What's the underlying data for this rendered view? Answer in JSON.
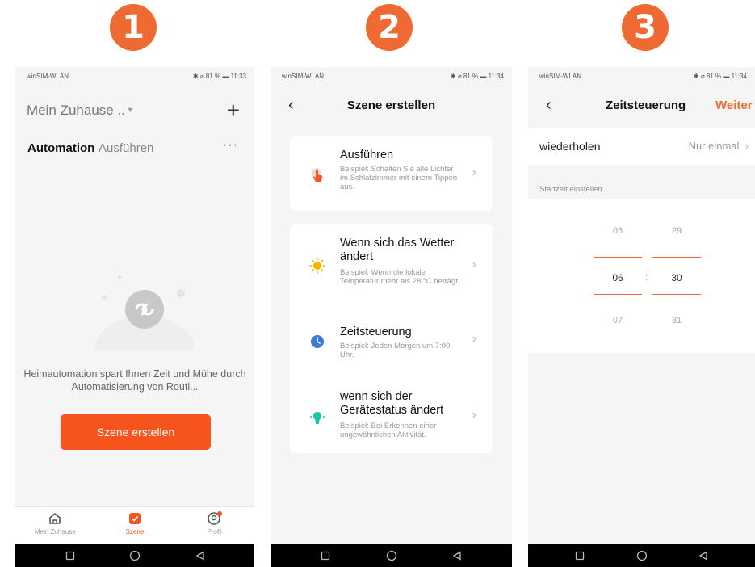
{
  "steps": [
    "1",
    "2",
    "3"
  ],
  "colors": {
    "accent": "#f6541c",
    "badge": "#ee6a32"
  },
  "phone1": {
    "status": {
      "carrier": "winSIM-WLAN",
      "right": "81 %",
      "time": "11:33"
    },
    "home_title": "Mein Zuhause ..",
    "tabs": {
      "automation": "Automation",
      "run": "Ausführen"
    },
    "more_icon": "more-horizontal-icon",
    "empty_text": "Heimautomation spart Ihnen Zeit und Mühe durch Automatisierung von Routi...",
    "create_button": "Szene erstellen",
    "bottom_tabs": [
      {
        "label": "Mein Zuhause",
        "icon": "home-icon"
      },
      {
        "label": "Szene",
        "icon": "scene-check-icon"
      },
      {
        "label": "Profil",
        "icon": "profile-icon"
      }
    ]
  },
  "phone2": {
    "status": {
      "carrier": "winSIM-WLAN",
      "right": "81 %",
      "time": "11:34"
    },
    "title": "Szene erstellen",
    "items": [
      {
        "title": "Ausführen",
        "desc": "Beispiel: Schalten Sie alle Lichter im Schlafzimmer mit einem Tippen aus.",
        "icon": "tap-hand-icon"
      },
      {
        "title": "Wenn sich das Wetter ändert",
        "desc": "Beispiel: Wenn die lokale Temperatur mehr als 28 °C beträgt.",
        "icon": "sun-icon"
      },
      {
        "title": "Zeitsteuerung",
        "desc": "Beispiel: Jeden Morgen um 7:00 Uhr.",
        "icon": "clock-icon"
      },
      {
        "title": "wenn sich der Gerätestatus ändert",
        "desc": "Beispiel: Bei Erkennen einer ungewöhnlichen Aktivität.",
        "icon": "device-bulb-icon"
      }
    ]
  },
  "phone3": {
    "status": {
      "carrier": "winSIM-WLAN",
      "right": "81 %",
      "time": "11:34"
    },
    "title": "Zeitsteuerung",
    "next": "Weiter",
    "repeat_label": "wiederholen",
    "repeat_value": "Nur einmal",
    "start_label": "Startzeit einstellen",
    "hours": [
      "05",
      "06",
      "07"
    ],
    "minutes": [
      "29",
      "30",
      "31"
    ],
    "separator": ":"
  }
}
